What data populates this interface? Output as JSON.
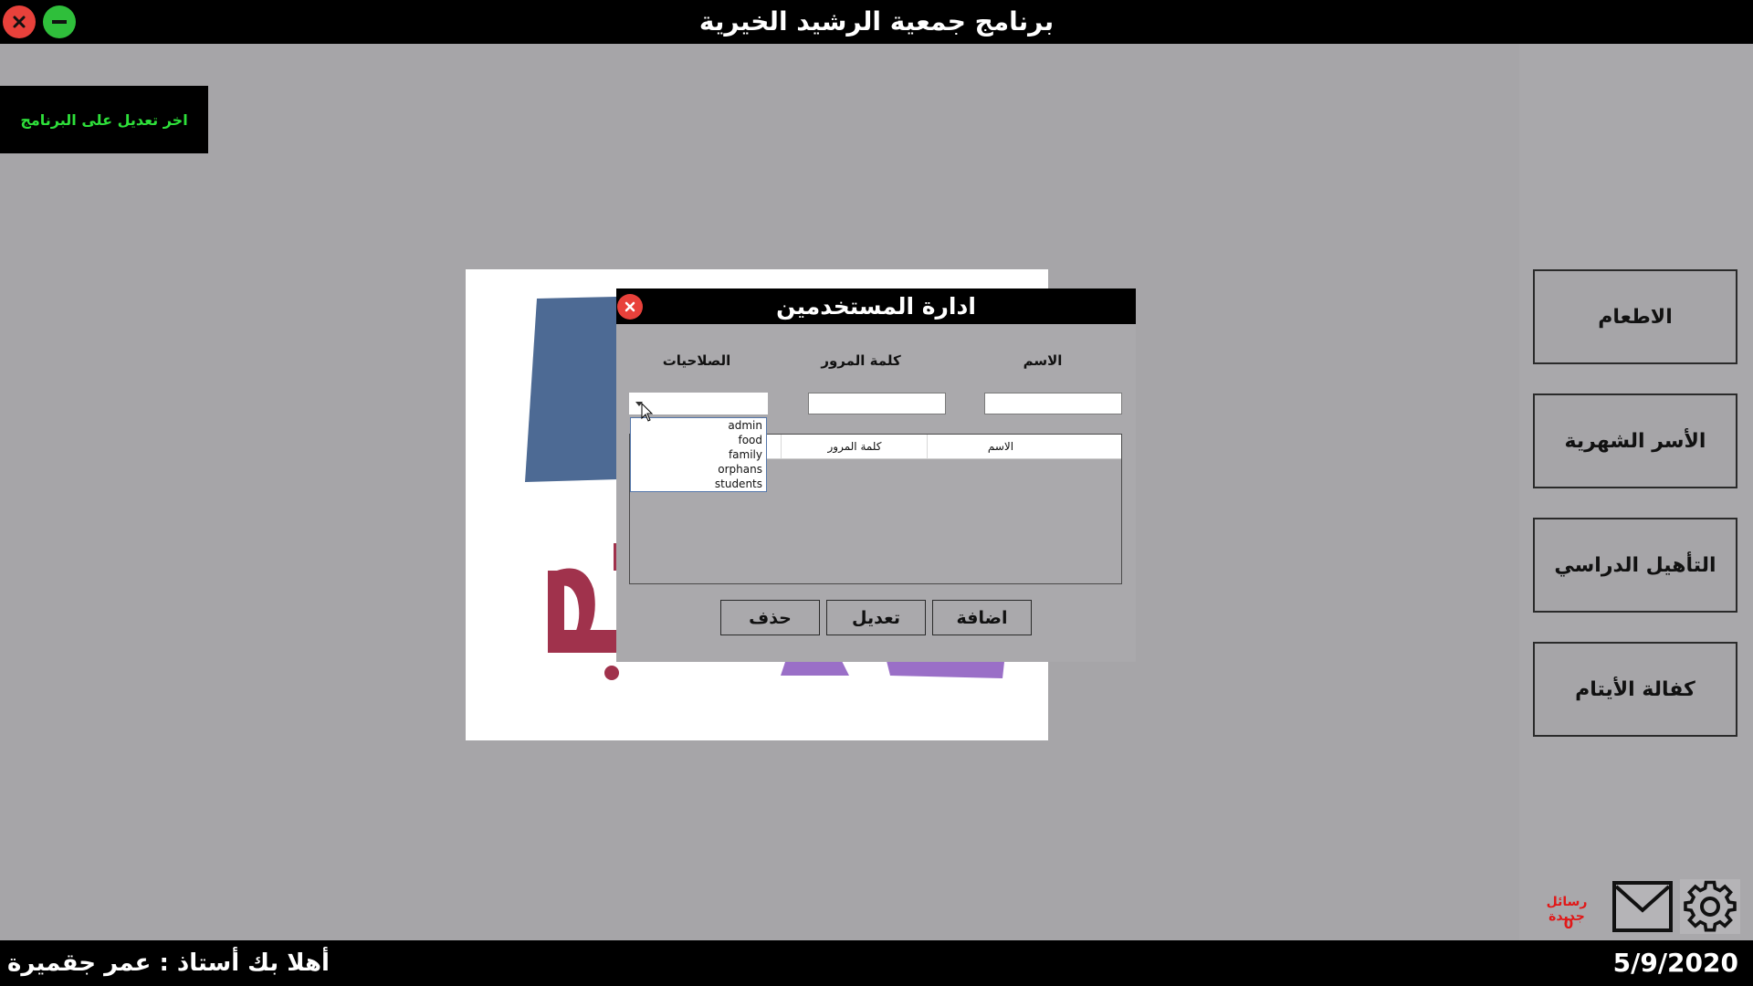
{
  "app": {
    "title": "برنامج جمعية الرشيد الخيرية",
    "last_edit_label": "اخر تعديل على البرنامج"
  },
  "nav": {
    "items": [
      {
        "label": "الاطعام"
      },
      {
        "label": "الأسر الشهرية"
      },
      {
        "label": "التأهيل الدراسي"
      },
      {
        "label": "كفالة الأيتام"
      }
    ]
  },
  "dialog": {
    "title": "ادارة المستخدمين",
    "labels": {
      "name": "الاسم",
      "password": "كلمة المرور",
      "permissions": "الصلاحيات"
    },
    "name_value": "",
    "password_value": "",
    "permissions_value": "",
    "permission_options": [
      "admin",
      "food",
      "family",
      "orphans",
      "students"
    ],
    "grid_columns": [
      "الاسم",
      "كلمة المرور"
    ],
    "buttons": {
      "add": "اضافة",
      "edit": "تعديل",
      "delete": "حذف"
    }
  },
  "messages": {
    "label": "رسائل جديدة",
    "count": "0"
  },
  "status": {
    "welcome": "أهلا بك أستاذ : عمر جقميرة",
    "date": "5/9/2020"
  },
  "colors": {
    "accent_green": "#2ee03a",
    "alert_red": "#e11818",
    "close_red": "#e8413b",
    "minimize_green": "#2fbf3b"
  },
  "icons": [
    "close-icon",
    "minimize-icon",
    "mail-icon",
    "gear-icon",
    "dropdown-arrow-icon",
    "mouse-pointer-icon"
  ]
}
